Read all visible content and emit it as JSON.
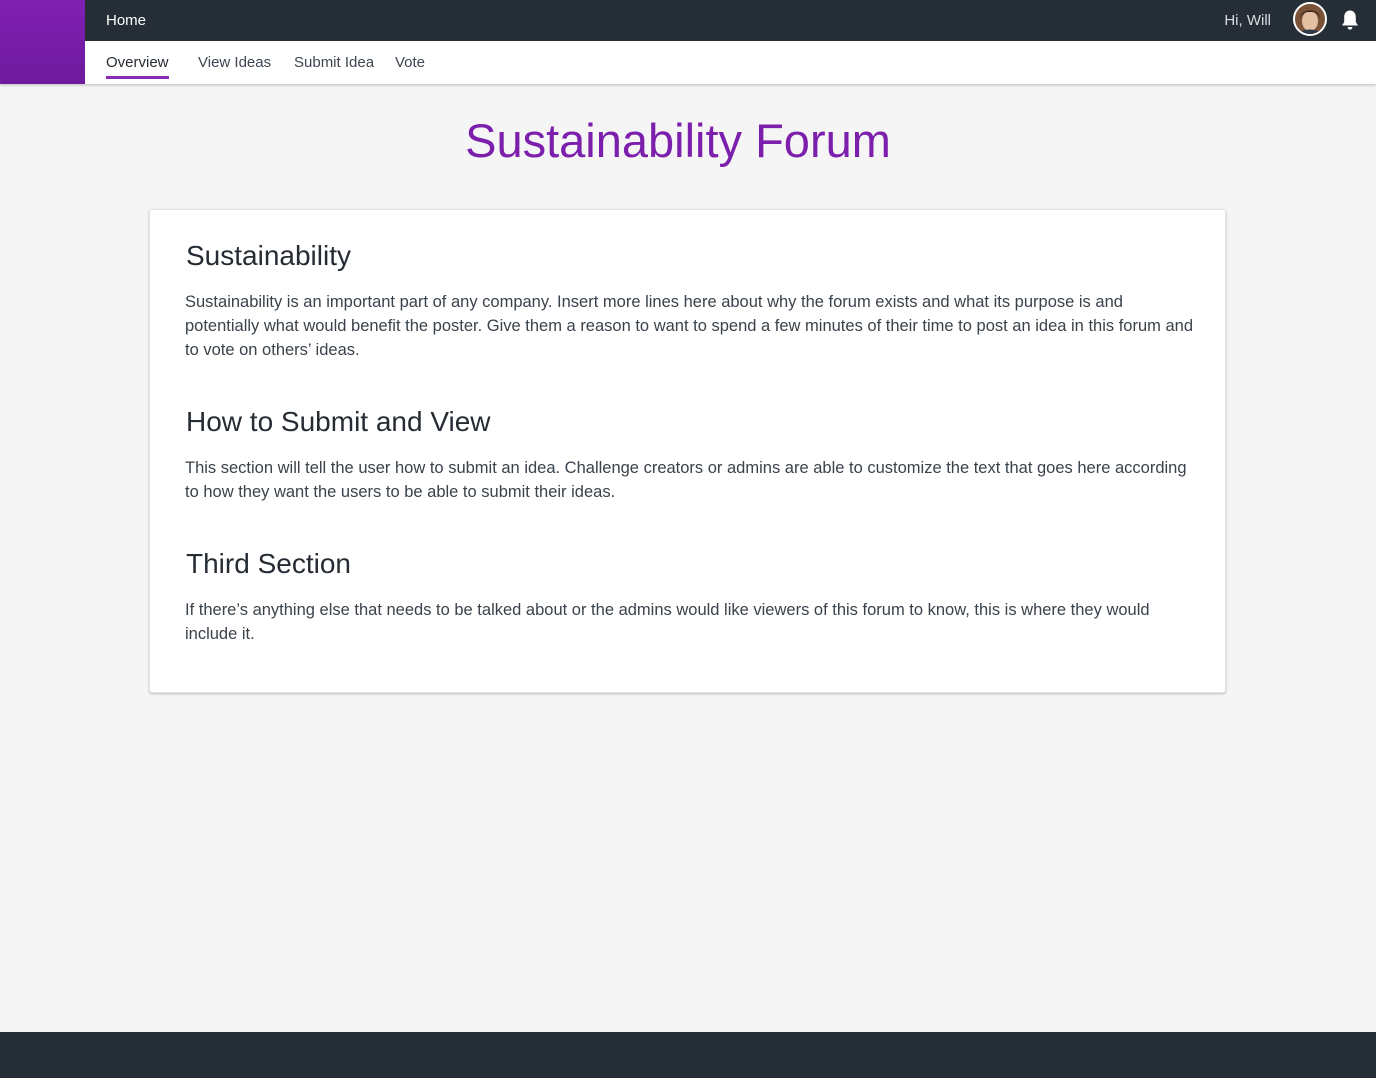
{
  "topbar": {
    "home_label": "Home",
    "greeting": "Hi, Will",
    "avatar_icon": "user-avatar-icon",
    "bell_icon": "bell-icon"
  },
  "nav": {
    "tabs": [
      {
        "label": "Overview",
        "active": true
      },
      {
        "label": "View Ideas",
        "active": false
      },
      {
        "label": "Submit Idea",
        "active": false
      },
      {
        "label": "Vote",
        "active": false
      }
    ]
  },
  "page": {
    "title": "Sustainability Forum"
  },
  "sections": [
    {
      "title": "Sustainability",
      "text": "Sustainability is an important part of any company. Insert more lines here about why the forum exists and what its purpose is and potentially what would benefit the poster. Give them a reason to want to spend a few minutes of their time to post an idea in this forum and to vote on others’ ideas."
    },
    {
      "title": "How to Submit and View",
      "text": "This section will tell the user how to submit an idea. Challenge creators or admins are able to customize the text that goes here according to how they want the users to be able to submit their ideas."
    },
    {
      "title": "Third Section",
      "text": "If there’s anything else that needs to be talked about or the admins would like viewers of this forum to know, this is where they would include it."
    }
  ],
  "colors": {
    "brand_purple": "#7d1fad",
    "topbar_bg": "#252d36",
    "page_bg": "#f5f5f5",
    "active_tab_underline": "#8a2ab8"
  }
}
